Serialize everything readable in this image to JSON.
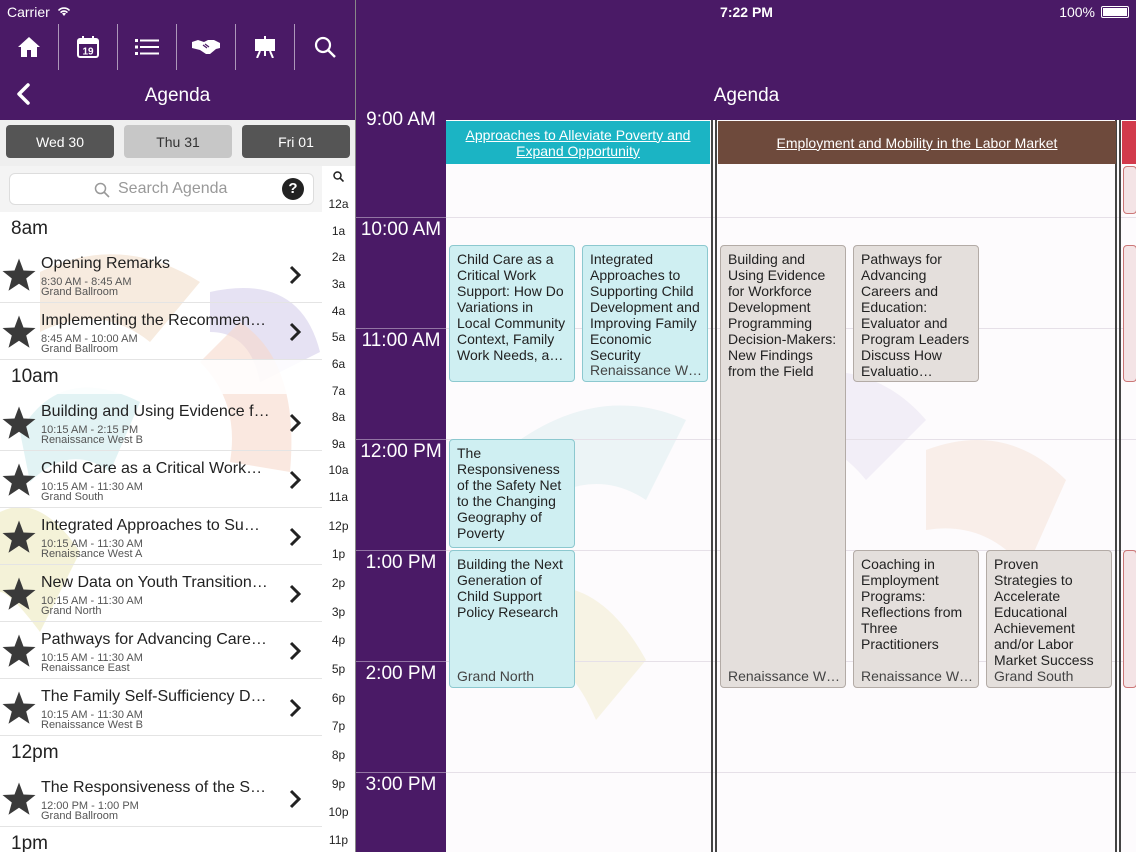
{
  "status": {
    "carrier": "Carrier",
    "time": "7:22 PM",
    "battery": "100%"
  },
  "toolbar": {
    "icons": [
      "home-icon",
      "calendar-icon",
      "list-icon",
      "handshake-icon",
      "presentation-icon",
      "search-icon"
    ],
    "calendar_day": "19"
  },
  "left": {
    "title": "Agenda",
    "days": [
      "Wed 30",
      "Thu 31",
      "Fri 01"
    ],
    "selected_day": "Thu 31",
    "search": {
      "placeholder": "Search Agenda"
    },
    "sections": [
      {
        "label": "8am",
        "items": [
          {
            "title": "Opening Remarks",
            "time": "8:30 AM - 8:45 AM",
            "location": "Grand Ballroom"
          },
          {
            "title": "Implementing the Recommen…",
            "time": "8:45 AM - 10:00 AM",
            "location": "Grand Ballroom"
          }
        ]
      },
      {
        "label": "10am",
        "items": [
          {
            "title": "Building and Using Evidence f…",
            "time": "10:15 AM - 2:15 PM",
            "location": "Renaissance West B"
          },
          {
            "title": "Child Care as a Critical Work…",
            "time": "10:15 AM - 11:30 AM",
            "location": "Grand South"
          },
          {
            "title": "Integrated Approaches to Su…",
            "time": "10:15 AM - 11:30 AM",
            "location": "Renaissance West A"
          },
          {
            "title": "New Data on Youth Transition…",
            "time": "10:15 AM - 11:30 AM",
            "location": "Grand North"
          },
          {
            "title": "Pathways for Advancing Care…",
            "time": "10:15 AM - 11:30 AM",
            "location": "Renaissance East"
          },
          {
            "title": "The Family Self-Sufficiency D…",
            "time": "10:15 AM - 11:30 AM",
            "location": "Renaissance West B"
          }
        ]
      },
      {
        "label": "12pm",
        "items": [
          {
            "title": "The Responsiveness of the S…",
            "time": "12:00 PM - 1:00 PM",
            "location": "Grand Ballroom"
          }
        ]
      },
      {
        "label": "1pm",
        "items": []
      }
    ],
    "index": [
      "12a",
      "1a",
      "2a",
      "3a",
      "4a",
      "5a",
      "6a",
      "7a",
      "8a",
      "9a",
      "10a",
      "11a",
      "12p",
      "1p",
      "2p",
      "3p",
      "4p",
      "5p",
      "6p",
      "7p",
      "8p",
      "9p",
      "10p",
      "11p"
    ]
  },
  "right": {
    "title": "Agenda",
    "times": [
      "9:00 AM",
      "10:00 AM",
      "11:00 AM",
      "12:00 PM",
      "1:00 PM",
      "2:00 PM",
      "3:00 PM"
    ],
    "tracks": [
      {
        "name": "Approaches to Alleviate Poverty and Expand Opportunity",
        "color": "#1bb4c4"
      },
      {
        "name": "Employment and Mobility in the Labor Market",
        "color": "#6e4a3c"
      },
      {
        "name": "",
        "color": "#d23a4c"
      }
    ],
    "sessions": [
      {
        "title": "Child Care as a Critical Work Support: How Do Variations in Local Community Context, Family Work Needs, a…",
        "location": ""
      },
      {
        "title": "Integrated Approaches to Supporting Child Development and Improving Family Economic Security",
        "location": "Renaissance W…"
      },
      {
        "title": "Building and Using Evidence for Workforce Development Programming Decision-Makers: New Findings from the Field",
        "location": "Renaissance W…"
      },
      {
        "title": "Pathways for Advancing Careers and Education: Evaluator and Program Leaders Discuss How Evaluatio…",
        "location": ""
      },
      {
        "title": "The Responsiveness of the Safety Net to the Changing Geography of Poverty",
        "location": ""
      },
      {
        "title": "Building the Next Generation of Child Support Policy Research",
        "location": "Grand North"
      },
      {
        "title": "Coaching in Employment Programs: Reflections from Three Practitioners",
        "location": "Renaissance W…"
      },
      {
        "title": "Proven Strategies to Accelerate Educational Achievement and/or Labor Market Success",
        "location": "Grand South"
      }
    ]
  }
}
